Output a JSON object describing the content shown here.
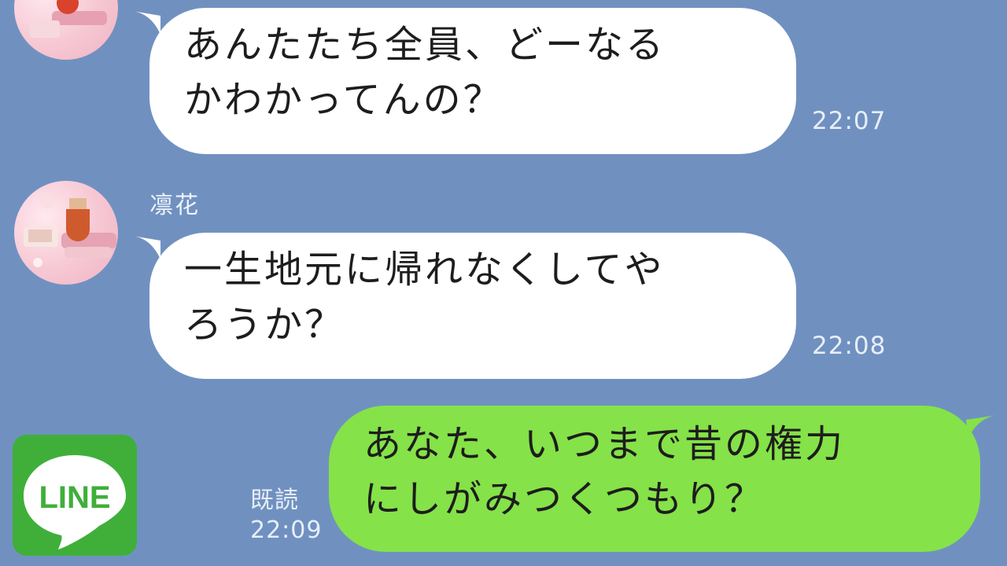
{
  "messages": [
    {
      "direction": "incoming",
      "text": "あんたたち全員、どーなる\nかわかってんの？",
      "time": "22:07"
    },
    {
      "direction": "incoming",
      "sender": "凛花",
      "text": "一生地元に帰れなくしてや\nろうか？",
      "time": "22:08"
    },
    {
      "direction": "outgoing",
      "text": "あなた、いつまで昔の権力\nにしがみつくつもり？",
      "read_label": "既読",
      "time": "22:09"
    }
  ],
  "logo": {
    "text": "LINE",
    "background": "#3faf3a"
  },
  "colors": {
    "background": "#7091c0",
    "incoming_bubble": "#ffffff",
    "outgoing_bubble": "#85e249"
  }
}
